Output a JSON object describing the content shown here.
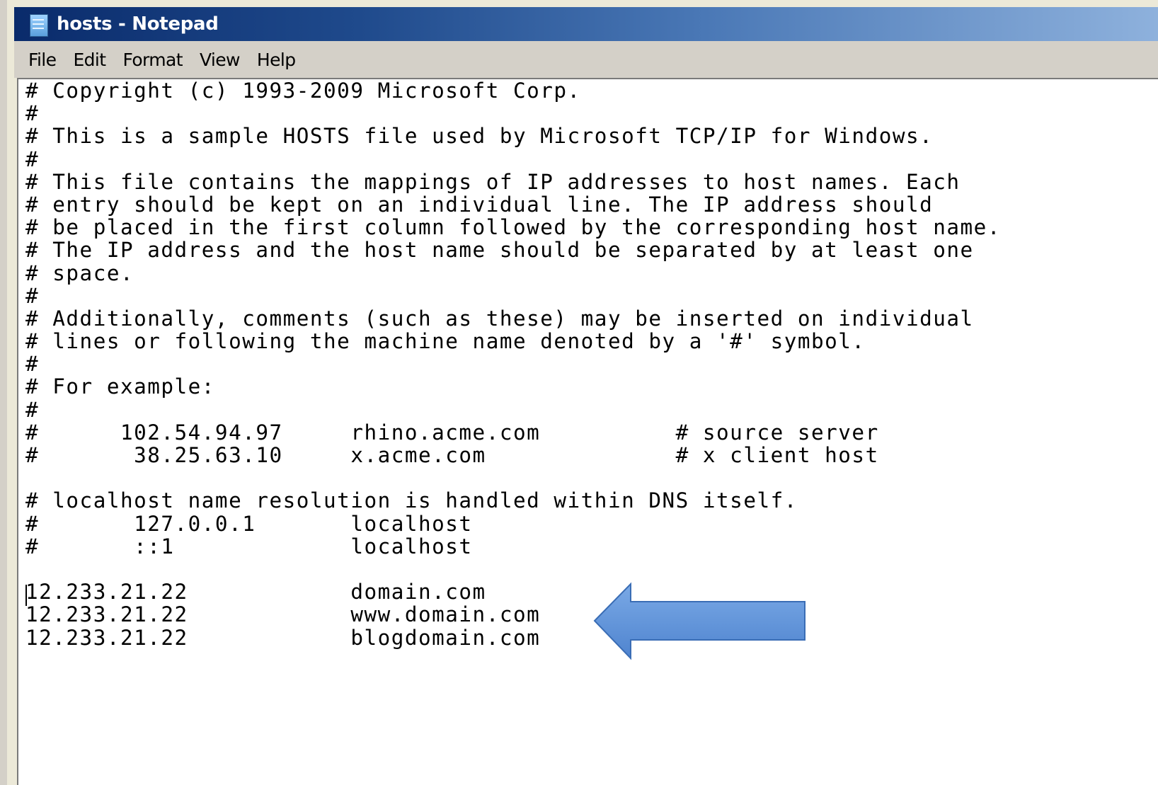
{
  "window": {
    "title": "hosts - Notepad",
    "icon": "notepad-icon"
  },
  "menubar": {
    "items": [
      "File",
      "Edit",
      "Format",
      "View",
      "Help"
    ]
  },
  "editor": {
    "lines": [
      "# Copyright (c) 1993-2009 Microsoft Corp.",
      "#",
      "# This is a sample HOSTS file used by Microsoft TCP/IP for Windows.",
      "#",
      "# This file contains the mappings of IP addresses to host names. Each",
      "# entry should be kept on an individual line. The IP address should",
      "# be placed in the first column followed by the corresponding host name.",
      "# The IP address and the host name should be separated by at least one",
      "# space.",
      "#",
      "# Additionally, comments (such as these) may be inserted on individual",
      "# lines or following the machine name denoted by a '#' symbol.",
      "#",
      "# For example:",
      "#",
      "#      102.54.94.97     rhino.acme.com          # source server",
      "#       38.25.63.10     x.acme.com              # x client host",
      "",
      "# localhost name resolution is handled within DNS itself.",
      "#       127.0.0.1       localhost",
      "#       ::1             localhost",
      "",
      "12.233.21.22            domain.com",
      "12.233.21.22            www.domain.com",
      "12.233.21.22            blogdomain.com"
    ]
  },
  "annotation": {
    "arrow_color": "#5b8fd6",
    "arrow_stroke": "#3a6db5",
    "icon": "left-arrow-icon"
  },
  "colors": {
    "title_start": "#0a2b6b",
    "title_end": "#8fb2dd",
    "menubar_bg": "#d4d0c8",
    "editor_bg": "#ffffff"
  }
}
